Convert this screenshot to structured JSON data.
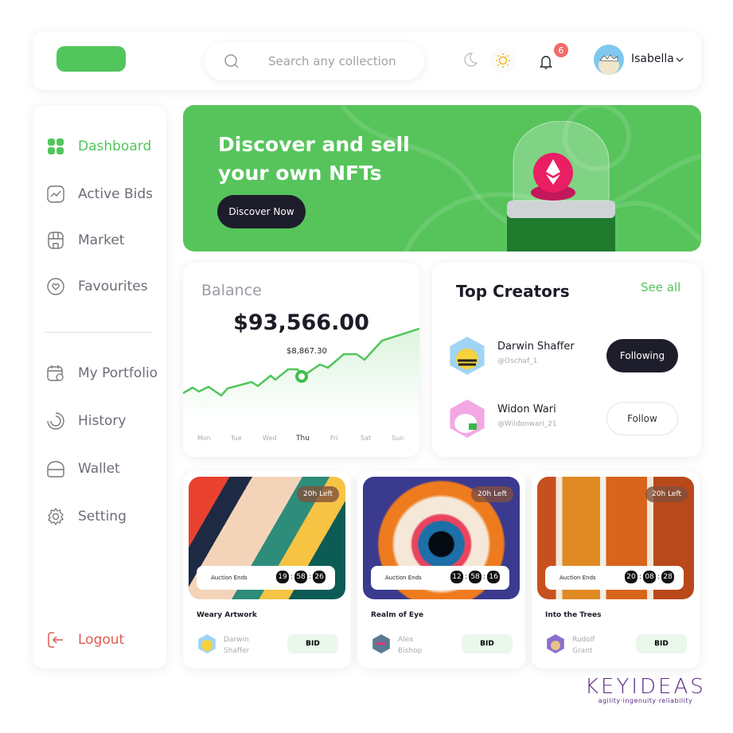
{
  "header": {
    "search_placeholder": "Search any collection",
    "notification_count": "6",
    "user_name": "Isabella"
  },
  "sidebar": {
    "items": [
      {
        "label": "Dashboard",
        "icon": "dashboard-icon",
        "active": true
      },
      {
        "label": "Active Bids",
        "icon": "chart-icon"
      },
      {
        "label": "Market",
        "icon": "store-icon"
      },
      {
        "label": "Favourites",
        "icon": "heart-icon"
      },
      {
        "label": "My Portfolio",
        "icon": "calendar-icon"
      },
      {
        "label": "History",
        "icon": "history-icon"
      },
      {
        "label": "Wallet",
        "icon": "wallet-icon"
      },
      {
        "label": "Setting",
        "icon": "gear-icon"
      }
    ],
    "logout": "Logout"
  },
  "banner": {
    "title": "Discover and sell your own NFTs",
    "button": "Discover Now"
  },
  "balance": {
    "title": "Balance",
    "amount": "$93,566.00",
    "tooltip": "$8,867.30",
    "days": [
      "Mon",
      "Tue",
      "Wed",
      "Thu",
      "Fri",
      "Sat",
      "Sun"
    ],
    "selected_day": "Thu"
  },
  "creators": {
    "title": "Top Creators",
    "see_all": "See all",
    "items": [
      {
        "name": "Darwin Shaffer",
        "handle": "@Oschaf_1",
        "button": "Following"
      },
      {
        "name": "Widon Wari",
        "handle": "@Wildonwari_21",
        "button": "Follow"
      }
    ]
  },
  "nfts": [
    {
      "name": "Weary Artwork",
      "left": "20h Left",
      "auction_label": "Auction Ends",
      "time": [
        "19",
        "58",
        "26"
      ],
      "owner": "Darwin Shaffer",
      "bid": "BID"
    },
    {
      "name": "Realm of Eye",
      "left": "20h Left",
      "auction_label": "Auction Ends",
      "time": [
        "12",
        "58",
        "16"
      ],
      "owner": "Alex Bishop",
      "bid": "BID"
    },
    {
      "name": "Into the Trees",
      "left": "20h Left",
      "auction_label": "Auction Ends",
      "time": [
        "20",
        "08",
        "28"
      ],
      "owner": "Rudolf Grant",
      "bid": "BID"
    }
  ],
  "brand": {
    "name": "KEYIDEAS",
    "tagline": "agility·ingenuity·reliability"
  },
  "colors": {
    "accent": "#52c55c",
    "dark": "#1d1d2b",
    "logout": "#e05a4f",
    "badge": "#f36b6b"
  }
}
